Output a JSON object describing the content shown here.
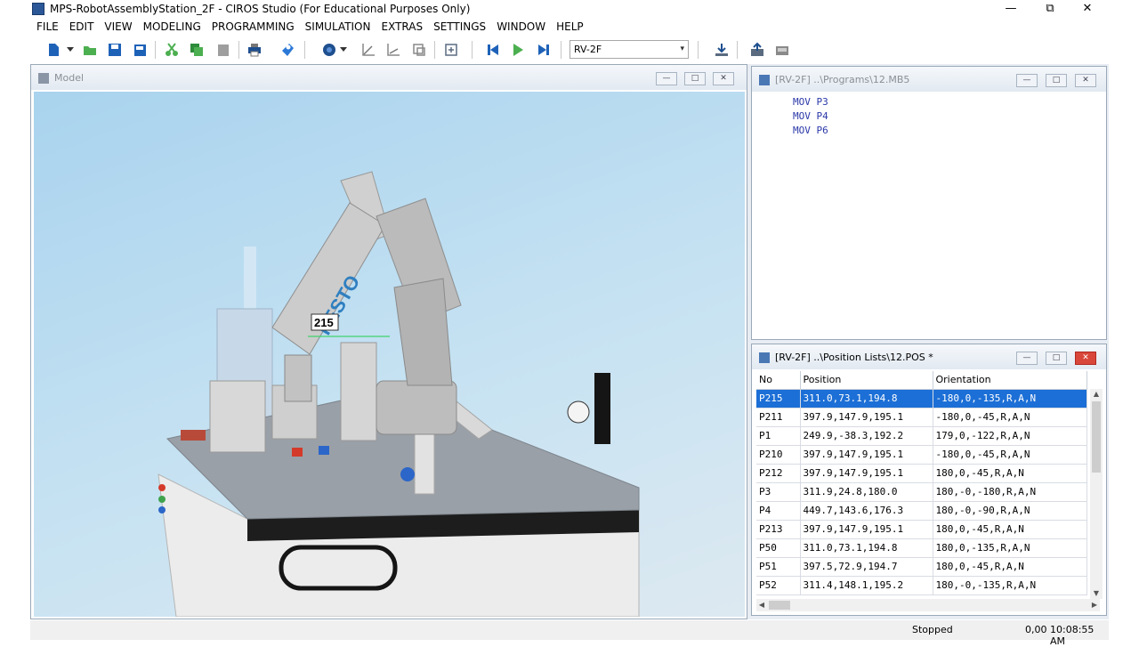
{
  "window": {
    "title": "MPS-RobotAssemblyStation_2F - CIROS Studio (For Educational Purposes Only)",
    "minimize": "—",
    "maximize": "⧉",
    "close": "✕"
  },
  "menu": [
    "FILE",
    "EDIT",
    "VIEW",
    "MODELING",
    "PROGRAMMING",
    "SIMULATION",
    "EXTRAS",
    "SETTINGS",
    "WINDOW",
    "HELP"
  ],
  "toolbar": {
    "robot_selected": "RV-2F",
    "dropdown_arrow": "▾",
    "icons": [
      "new-icon",
      "open-icon",
      "save-icon",
      "save-all-icon",
      "cut-icon",
      "copy-icon",
      "paste-icon",
      "print-icon",
      "help-icon",
      "view-icon",
      "axis-icon",
      "axis2-icon",
      "axis3-icon",
      "reset-icon",
      "skip-back-icon",
      "play-icon",
      "step-icon",
      "download-icon",
      "upload-icon",
      "network-icon"
    ],
    "colors": {
      "accent": "#2e7d32",
      "blue": "#1565c0"
    }
  },
  "model_pane": {
    "title": "Model",
    "label_215": "215",
    "robot_logo": "FESTO",
    "btn_min": "—",
    "btn_max": "□",
    "btn_close": "✕"
  },
  "program_pane": {
    "title": "[RV-2F] ..\\Programs\\12.MB5",
    "lines": [
      "MOV P3",
      "MOV P4",
      "MOV P6"
    ],
    "btn_min": "—",
    "btn_max": "□",
    "btn_close": "✕"
  },
  "position_pane": {
    "title": "[RV-2F] ..\\Position Lists\\12.POS *",
    "btn_min": "—",
    "btn_max": "□",
    "btn_close": "✕",
    "scroll_up": "▲",
    "scroll_down": "▼",
    "scroll_left": "◀",
    "scroll_right": "▶",
    "columns": [
      "No",
      "Position",
      "Orientation"
    ],
    "rows": [
      {
        "no": "P215",
        "pos": "311.0,73.1,194.8",
        "ori": "-180,0,-135,R,A,N"
      },
      {
        "no": "P211",
        "pos": "397.9,147.9,195.1",
        "ori": "-180,0,-45,R,A,N"
      },
      {
        "no": "P1",
        "pos": "249.9,-38.3,192.2",
        "ori": "179,0,-122,R,A,N"
      },
      {
        "no": "P210",
        "pos": "397.9,147.9,195.1",
        "ori": "-180,0,-45,R,A,N"
      },
      {
        "no": "P212",
        "pos": "397.9,147.9,195.1",
        "ori": "180,0,-45,R,A,N"
      },
      {
        "no": "P3",
        "pos": "311.9,24.8,180.0",
        "ori": "180,-0,-180,R,A,N"
      },
      {
        "no": "P4",
        "pos": "449.7,143.6,176.3",
        "ori": "180,-0,-90,R,A,N"
      },
      {
        "no": "P213",
        "pos": "397.9,147.9,195.1",
        "ori": "180,0,-45,R,A,N"
      },
      {
        "no": "P50",
        "pos": "311.0,73.1,194.8",
        "ori": "180,0,-135,R,A,N"
      },
      {
        "no": "P51",
        "pos": "397.5,72.9,194.7",
        "ori": "180,0,-45,R,A,N"
      },
      {
        "no": "P52",
        "pos": "311.4,148.1,195.2",
        "ori": "180,-0,-135,R,A,N"
      }
    ]
  },
  "status": {
    "state": "Stopped",
    "value": "0,00",
    "time": "10:08:55 AM"
  }
}
